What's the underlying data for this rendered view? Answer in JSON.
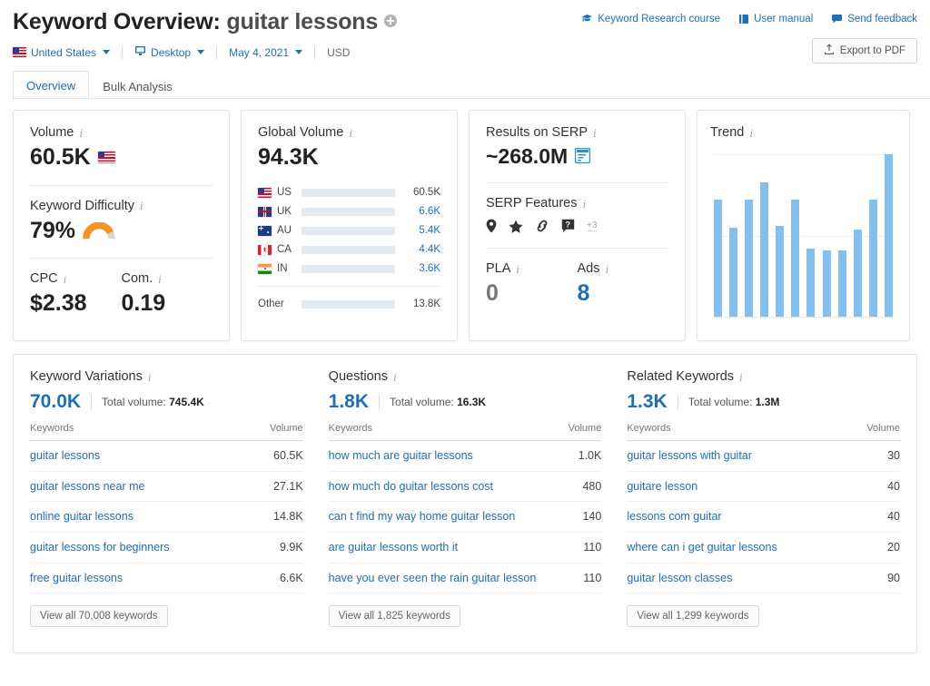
{
  "header": {
    "title_prefix": "Keyword Overview:",
    "keyword": "guitar lessons",
    "add_icon": "plus-circle-icon",
    "links": [
      {
        "label": "Keyword Research course",
        "icon": "graduation-cap-icon"
      },
      {
        "label": "User manual",
        "icon": "book-icon"
      },
      {
        "label": "Send feedback",
        "icon": "speech-bubble-icon"
      }
    ],
    "export_label": "Export to PDF",
    "export_icon": "upload-icon",
    "filters": {
      "country": "United States",
      "country_flag": "flag-us-icon",
      "device": "Desktop",
      "device_icon": "monitor-icon",
      "date": "May 4, 2021",
      "currency": "USD"
    },
    "tabs": [
      {
        "label": "Overview",
        "active": true
      },
      {
        "label": "Bulk Analysis",
        "active": false
      }
    ]
  },
  "colors": {
    "link_blue": "#1f6fb4",
    "bar_primary": "#1a73bd",
    "bar_light": "#7cb9ec",
    "trend_bar": "#84bfed",
    "gauge_orange": "#f79321",
    "gauge_track": "#d6d6d6"
  },
  "cards": {
    "volume": {
      "label": "Volume",
      "value": "60.5K",
      "flag": "flag-us-icon",
      "keyword_difficulty": {
        "label": "Keyword Difficulty",
        "value": "79%",
        "percent": 79
      },
      "cpc": {
        "label": "CPC",
        "value": "$2.38"
      },
      "com": {
        "label": "Com.",
        "value": "0.19"
      }
    },
    "global_volume": {
      "label": "Global Volume",
      "value": "94.3K",
      "other_label": "Other"
    },
    "serp": {
      "label": "Results on SERP",
      "value": "~268.0M",
      "snippet_icon": "featured-snippet-icon",
      "features_label": "SERP Features",
      "features": [
        "map-pin-icon",
        "star-icon",
        "link-icon",
        "question-bubble-icon"
      ],
      "features_more": "+3",
      "pla": {
        "label": "PLA",
        "value": "0"
      },
      "ads": {
        "label": "Ads",
        "value": "8"
      }
    },
    "trend": {
      "label": "Trend"
    }
  },
  "chart_data": [
    {
      "type": "bar",
      "title": "Global Volume",
      "orientation": "horizontal",
      "xlabel": "",
      "ylabel": "",
      "total": "94.3K",
      "categories": [
        "US",
        "UK",
        "AU",
        "CA",
        "IN",
        "Other"
      ],
      "value_labels": [
        "60.5K",
        "6.6K",
        "5.4K",
        "4.4K",
        "3.6K",
        "13.8K"
      ],
      "values": [
        60500,
        6600,
        5400,
        4400,
        3600,
        13800
      ],
      "bar_fill_percent": [
        64,
        8,
        7,
        6,
        5,
        16
      ],
      "flags": [
        "flag-us-icon",
        "flag-uk-icon",
        "flag-au-icon",
        "flag-ca-icon",
        "flag-in-icon",
        null
      ],
      "grid": false,
      "legend": "none"
    },
    {
      "type": "bar",
      "title": "Trend",
      "xlabel": "",
      "ylabel": "",
      "categories": [
        "1",
        "2",
        "3",
        "4",
        "5",
        "6",
        "7",
        "8",
        "9",
        "10",
        "11",
        "12"
      ],
      "values": [
        0.72,
        0.55,
        0.72,
        0.83,
        0.56,
        0.72,
        0.42,
        0.41,
        0.41,
        0.54,
        0.72,
        1.0
      ],
      "ylim": [
        0,
        1
      ],
      "grid": true,
      "legend": "none"
    }
  ],
  "panels": [
    {
      "title": "Keyword Variations",
      "count": "70.0K",
      "total_prefix": "Total volume:",
      "total": "745.4K",
      "columns": [
        "Keywords",
        "Volume"
      ],
      "rows": [
        {
          "keyword": "guitar lessons",
          "volume": "60.5K"
        },
        {
          "keyword": "guitar lessons near me",
          "volume": "27.1K"
        },
        {
          "keyword": "online guitar lessons",
          "volume": "14.8K"
        },
        {
          "keyword": "guitar lessons for beginners",
          "volume": "9.9K"
        },
        {
          "keyword": "free guitar lessons",
          "volume": "6.6K"
        }
      ],
      "view_all": "View all 70,008 keywords"
    },
    {
      "title": "Questions",
      "count": "1.8K",
      "total_prefix": "Total volume:",
      "total": "16.3K",
      "columns": [
        "Keywords",
        "Volume"
      ],
      "rows": [
        {
          "keyword": "how much are guitar lessons",
          "volume": "1.0K"
        },
        {
          "keyword": "how much do guitar lessons cost",
          "volume": "480"
        },
        {
          "keyword": "can t find my way home guitar lesson",
          "volume": "140"
        },
        {
          "keyword": "are guitar lessons worth it",
          "volume": "110"
        },
        {
          "keyword": "have you ever seen the rain guitar lesson",
          "volume": "110"
        }
      ],
      "view_all": "View all 1,825 keywords"
    },
    {
      "title": "Related Keywords",
      "count": "1.3K",
      "total_prefix": "Total volume:",
      "total": "1.3M",
      "columns": [
        "Keywords",
        "Volume"
      ],
      "rows": [
        {
          "keyword": "guitar lessons with guitar",
          "volume": "30"
        },
        {
          "keyword": "guitare lesson",
          "volume": "40"
        },
        {
          "keyword": "lessons com guitar",
          "volume": "40"
        },
        {
          "keyword": "where can i get guitar lessons",
          "volume": "20"
        },
        {
          "keyword": "guitar lesson classes",
          "volume": "90"
        }
      ],
      "view_all": "View all 1,299 keywords"
    }
  ]
}
